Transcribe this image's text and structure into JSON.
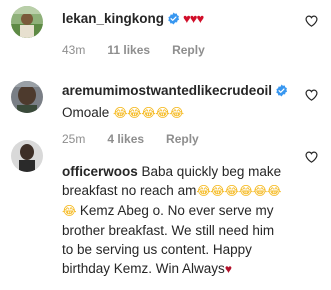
{
  "comments": [
    {
      "username": "lekan_kingkong",
      "hearts": "♥♥♥",
      "time": "43m",
      "likes": "11 likes",
      "reply": "Reply"
    },
    {
      "username": "aremumimostwantedlikecrudeoil",
      "text": "Omoale",
      "emojis": "😂😂😂😂😂",
      "time": "25m",
      "likes": "4 likes",
      "reply": "Reply"
    },
    {
      "username": "officerwoos",
      "text_line1": "Baba quickly beg make",
      "text_line2": "breakfast no reach am",
      "emojis_line2": "😂😂😂😂😂😂",
      "emoji_line3": "😂",
      "text_line3": "Kemz Abeg o. No ever serve my",
      "text_line4": "brother breakfast. We still need him",
      "text_line5": "to be serving us content. Happy",
      "text_line6": "birthday Kemz. Win Always",
      "end_heart": "♥"
    }
  ],
  "colors": {
    "username": "#262626",
    "meta": "#8e8e8e",
    "verified": "#3897f0",
    "heart": "#d10f2a"
  },
  "icons": {
    "verified": "verified-badge-icon",
    "like": "heart-outline-icon"
  }
}
